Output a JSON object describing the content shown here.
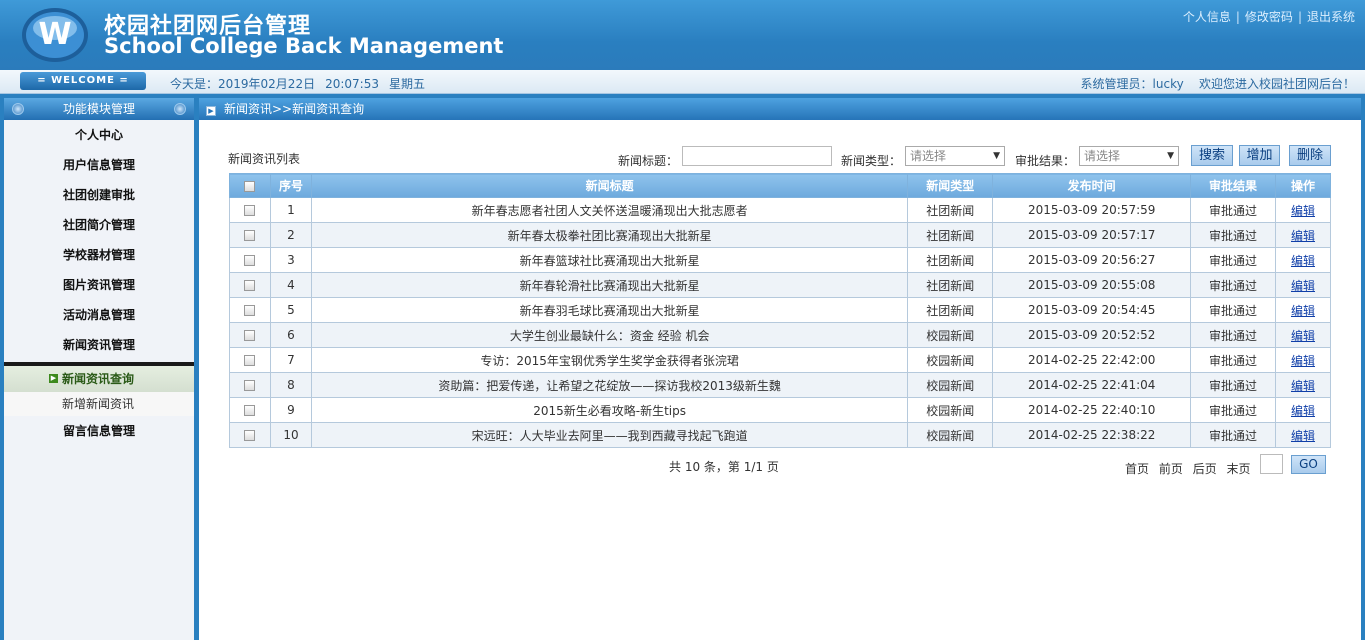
{
  "header": {
    "title_cn": "校园社团网后台管理",
    "title_en": "School College Back Management",
    "links": [
      "个人信息",
      "修改密码",
      "退出系统"
    ]
  },
  "welcome": {
    "badge": "= WELCOME =",
    "today_label": "今天是：2019年02月22日",
    "time": "20:07:53",
    "weekday": "星期五",
    "admin": "系统管理员：lucky",
    "greeting": "欢迎您进入校园社团网后台！"
  },
  "sidebar": {
    "head": "功能模块管理",
    "items": [
      "个人中心",
      "用户信息管理",
      "社团创建审批",
      "社团简介管理",
      "学校器材管理",
      "图片资讯管理",
      "活动消息管理",
      "新闻资讯管理"
    ],
    "active": "新闻资讯查询",
    "sub": "新增新闻资讯",
    "last": "留言信息管理"
  },
  "main": {
    "breadcrumb": "新闻资讯>>新闻资讯查询",
    "list_title": "新闻资讯列表",
    "filters": {
      "title_label": "新闻标题：",
      "title_value": "",
      "type_label": "新闻类型：",
      "type_value": "请选择",
      "result_label": "审批结果：",
      "result_value": "请选择"
    },
    "buttons": {
      "search": "搜索",
      "add": "增加",
      "delete": "删除"
    },
    "table": {
      "headers": [
        "序号",
        "新闻标题",
        "新闻类型",
        "发布时间",
        "审批结果",
        "操作"
      ],
      "rows": [
        {
          "no": "1",
          "title": "新年春志愿者社团人文关怀送温暖涌现出大批志愿者",
          "type": "社团新闻",
          "time": "2015-03-09 20:57:59",
          "result": "审批通过",
          "op": "编辑"
        },
        {
          "no": "2",
          "title": "新年春太极拳社团比赛涌现出大批新星",
          "type": "社团新闻",
          "time": "2015-03-09 20:57:17",
          "result": "审批通过",
          "op": "编辑"
        },
        {
          "no": "3",
          "title": "新年春篮球社比赛涌现出大批新星",
          "type": "社团新闻",
          "time": "2015-03-09 20:56:27",
          "result": "审批通过",
          "op": "编辑"
        },
        {
          "no": "4",
          "title": "新年春轮滑社比赛涌现出大批新星",
          "type": "社团新闻",
          "time": "2015-03-09 20:55:08",
          "result": "审批通过",
          "op": "编辑"
        },
        {
          "no": "5",
          "title": "新年春羽毛球比赛涌现出大批新星",
          "type": "社团新闻",
          "time": "2015-03-09 20:54:45",
          "result": "审批通过",
          "op": "编辑"
        },
        {
          "no": "6",
          "title": "大学生创业最缺什么：资金 经验 机会",
          "type": "校园新闻",
          "time": "2015-03-09 20:52:52",
          "result": "审批通过",
          "op": "编辑"
        },
        {
          "no": "7",
          "title": "专访：2015年宝钢优秀学生奖学金获得者张浣珺",
          "type": "校园新闻",
          "time": "2014-02-25 22:42:00",
          "result": "审批通过",
          "op": "编辑"
        },
        {
          "no": "8",
          "title": "资助篇：把爱传递，让希望之花绽放——探访我校2013级新生魏",
          "type": "校园新闻",
          "time": "2014-02-25 22:41:04",
          "result": "审批通过",
          "op": "编辑"
        },
        {
          "no": "9",
          "title": "2015新生必看攻略-新生tips",
          "type": "校园新闻",
          "time": "2014-02-25 22:40:10",
          "result": "审批通过",
          "op": "编辑"
        },
        {
          "no": "10",
          "title": "宋远旺：人大毕业去阿里——我到西藏寻找起飞跑道",
          "type": "校园新闻",
          "time": "2014-02-25 22:38:22",
          "result": "审批通过",
          "op": "编辑"
        }
      ]
    },
    "pager": {
      "summary": "共 10 条，第 1/1 页",
      "links": [
        "首页",
        "前页",
        "后页",
        "末页"
      ],
      "go": "GO"
    }
  }
}
